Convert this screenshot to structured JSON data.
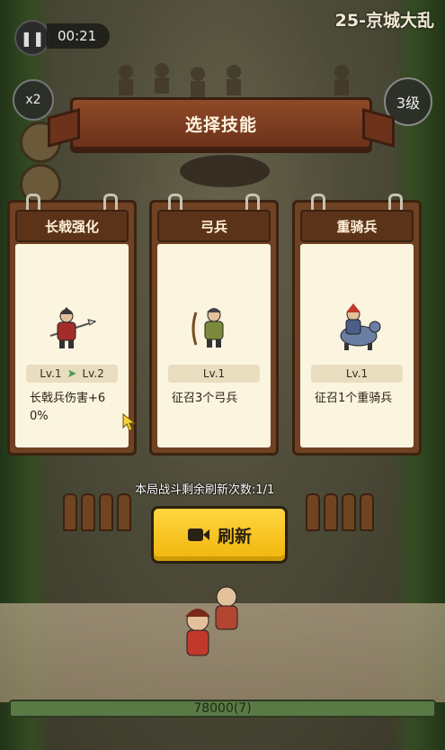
{
  "hud": {
    "pause_icon": "pause-icon",
    "timer": "00:21",
    "level_title": "25-京城大乱",
    "speed": "x2",
    "grade": "3级"
  },
  "dialog": {
    "title": "选择技能",
    "cards": [
      {
        "title": "长戟强化",
        "level_from": "Lv.1",
        "level_to": "Lv.2",
        "desc": "长戟兵伤害+60%",
        "unit_icon": "halberd-soldier-icon"
      },
      {
        "title": "弓兵",
        "level": "Lv.1",
        "desc": "征召3个弓兵",
        "unit_icon": "archer-icon"
      },
      {
        "title": "重骑兵",
        "level": "Lv.1",
        "desc": "征召1个重骑兵",
        "unit_icon": "heavy-cavalry-icon"
      }
    ],
    "refresh_left": "本局战斗剩余刷新次数:1/1",
    "refresh_label": "刷新"
  },
  "bottom": {
    "score": "78000(7)"
  },
  "colors": {
    "button_yellow": "#f5c11c",
    "card_frame": "#6e4223",
    "card_paper": "#fbf4df",
    "banner": "#8e4a28"
  }
}
